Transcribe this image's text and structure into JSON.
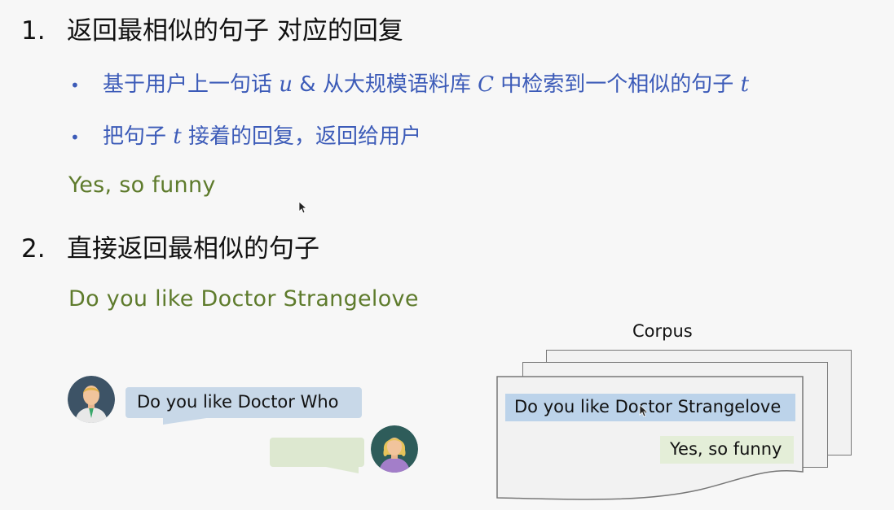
{
  "section1": {
    "number": "1.",
    "title": "返回最相似的句子 对应的回复",
    "bullets": [
      {
        "pre": "基于用户上一句话",
        "var1": "u",
        "mid": "& 从大规模语料库",
        "var2": "C",
        "post": "中检索到一个相似的句子",
        "var3": "t"
      },
      {
        "pre": "把句子",
        "var1": "t",
        "post": "接着的回复，返回给用户"
      }
    ],
    "example": "Yes, so funny"
  },
  "section2": {
    "number": "2.",
    "title": "直接返回最相似的句子",
    "example": "Do you like Doctor Strangelove"
  },
  "chat": {
    "user_message": "Do you like Doctor Who",
    "reply_message": ""
  },
  "corpus": {
    "label": "Corpus",
    "matched_sentence": "Do you like Doctor Strangelove",
    "response": "Yes, so funny"
  },
  "colors": {
    "heading": "#111111",
    "bullet_blue": "#3c5bb8",
    "example_green": "#5e7b2c",
    "user_bubble": "#c8d8e8",
    "reply_bubble": "#dde8d0",
    "corpus_highlight": "#bcd3ea",
    "response_highlight": "#e4eed8"
  }
}
